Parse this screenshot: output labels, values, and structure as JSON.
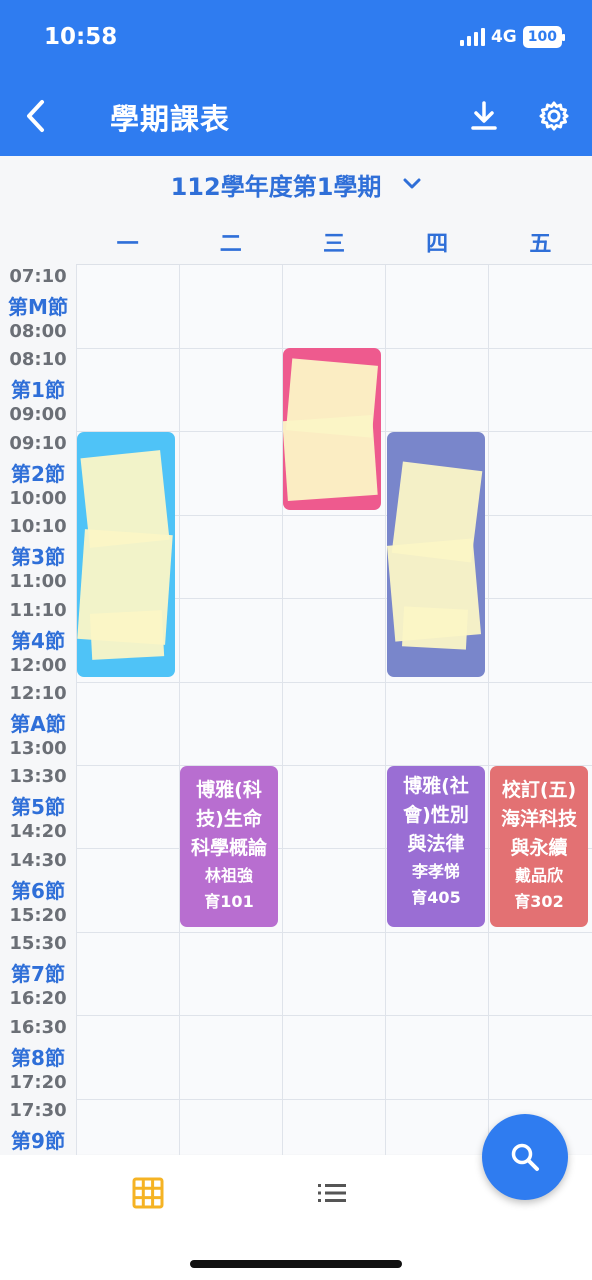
{
  "status": {
    "time": "10:58",
    "network": "4G",
    "battery": "100"
  },
  "header": {
    "title": "學期課表"
  },
  "term": {
    "label": "112學年度第1學期"
  },
  "days": [
    "一",
    "二",
    "三",
    "四",
    "五"
  ],
  "periods": [
    {
      "start": "07:10",
      "name": "第M節",
      "end": "08:00"
    },
    {
      "start": "08:10",
      "name": "第1節",
      "end": "09:00"
    },
    {
      "start": "09:10",
      "name": "第2節",
      "end": "10:00"
    },
    {
      "start": "10:10",
      "name": "第3節",
      "end": "11:00"
    },
    {
      "start": "11:10",
      "name": "第4節",
      "end": "12:00"
    },
    {
      "start": "12:10",
      "name": "第A節",
      "end": "13:00"
    },
    {
      "start": "13:30",
      "name": "第5節",
      "end": "14:20"
    },
    {
      "start": "14:30",
      "name": "第6節",
      "end": "15:20"
    },
    {
      "start": "15:30",
      "name": "第7節",
      "end": "16:20"
    },
    {
      "start": "16:30",
      "name": "第8節",
      "end": "17:20"
    },
    {
      "start": "17:30",
      "name": "第9節",
      "end": ""
    }
  ],
  "courses": [
    {
      "name_line1": "博雅(科",
      "name_line2": "技)生命",
      "name_line3": "科學概論",
      "teacher": "林祖強",
      "room": "育101",
      "color": "#b86ed0"
    },
    {
      "name_line1": "博雅(社",
      "name_line2": "會)性別",
      "name_line3": "與法律",
      "teacher": "李孝悌",
      "room": "育405",
      "color": "#9a6ed4"
    },
    {
      "name_line1": "校訂(五)",
      "name_line2": "海洋科技",
      "name_line3": "與永續",
      "teacher": "戴品欣",
      "room": "育302",
      "color": "#e37173"
    }
  ],
  "colors": {
    "accent": "#2f7cf0",
    "block_monday": "#4fc3f7",
    "block_wednesday": "#ee5a8e",
    "block_thursday": "#7986cb",
    "tab_active": "#f5b324"
  },
  "icons": {
    "back": "chevron-left-icon",
    "download": "download-icon",
    "settings": "gear-icon",
    "dropdown": "chevron-down-icon",
    "search": "search-icon",
    "grid": "grid-icon",
    "list": "list-icon"
  }
}
